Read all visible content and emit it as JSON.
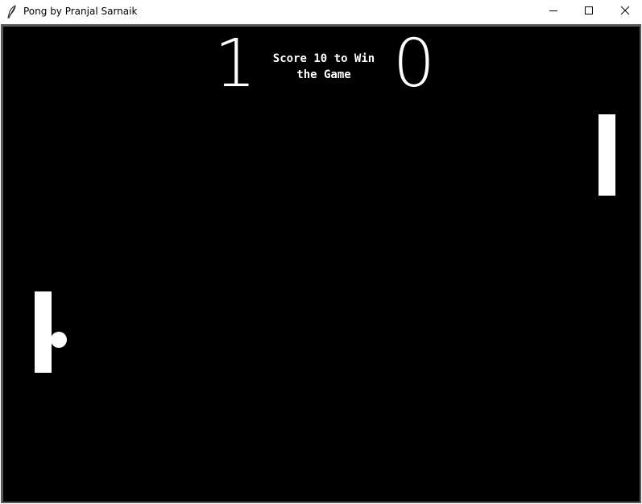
{
  "window": {
    "title": "Pong by Pranjal Sarnaik",
    "icon": "feather-icon",
    "controls": {
      "minimize_icon": "minimize-icon",
      "maximize_icon": "maximize-icon",
      "close_icon": "close-icon"
    }
  },
  "game": {
    "score_left": "1",
    "score_right": "0",
    "win_message": "Score 10 to Win\nthe Game",
    "background_color": "#000000",
    "foreground_color": "#ffffff"
  }
}
